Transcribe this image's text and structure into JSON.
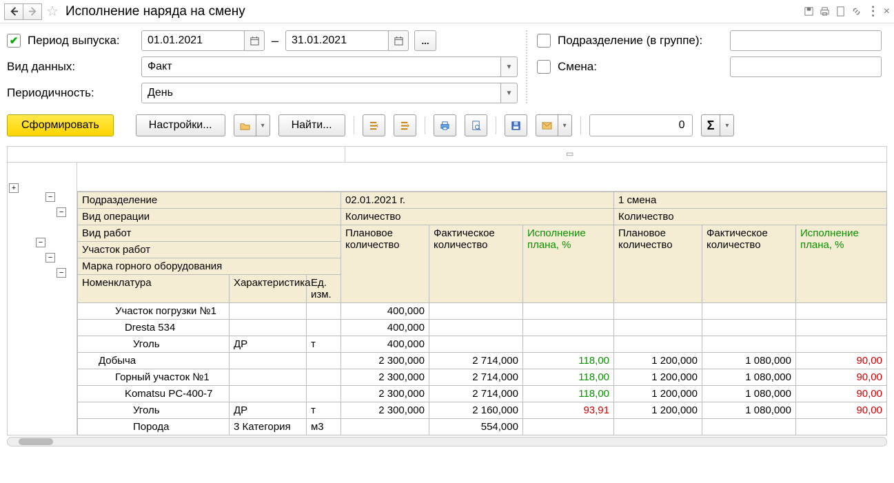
{
  "window": {
    "title": "Исполнение наряда на смену"
  },
  "filters": {
    "periodLabel": "Период выпуска:",
    "dateFrom": "01.01.2021",
    "dateTo": "31.01.2021",
    "dataTypeLabel": "Вид данных:",
    "dataType": "Факт",
    "periodicityLabel": "Периодичность:",
    "periodicity": "День",
    "unitLabel": "Подразделение (в группе):",
    "shiftLabel": "Смена:",
    "ellipsis": "..."
  },
  "toolbar": {
    "generate": "Сформировать",
    "settings": "Настройки...",
    "find": "Найти...",
    "counter": "0",
    "sigma": "Σ"
  },
  "headers": {
    "unit": "Подразделение",
    "opType": "Вид операции",
    "workType": "Вид работ",
    "workArea": "Участок работ",
    "equipment": "Марка горного оборудования",
    "nomenclature": "Номенклатура",
    "characteristic": "Характеристика",
    "uom": "Ед. изм.",
    "date": "02.01.2021 г.",
    "shift": "1 смена",
    "qty": "Количество",
    "plan": "Плановое количество",
    "fact": "Фактическое количество",
    "exec": "Исполнение плана, %"
  },
  "rows": [
    {
      "name": "Участок погрузки №1",
      "char": "",
      "uom": "",
      "indent": 2,
      "d": {
        "plan": "400,000",
        "fact": "",
        "exec": "",
        "execClass": ""
      },
      "s": {
        "plan": "",
        "fact": "",
        "exec": "",
        "execClass": ""
      }
    },
    {
      "name": "Dresta 534",
      "char": "",
      "uom": "",
      "indent": 3,
      "d": {
        "plan": "400,000",
        "fact": "",
        "exec": "",
        "execClass": ""
      },
      "s": {
        "plan": "",
        "fact": "",
        "exec": "",
        "execClass": ""
      }
    },
    {
      "name": "Уголь",
      "char": "ДР",
      "uom": "т",
      "indent": 4,
      "d": {
        "plan": "400,000",
        "fact": "",
        "exec": "",
        "execClass": ""
      },
      "s": {
        "plan": "",
        "fact": "",
        "exec": "",
        "execClass": ""
      }
    },
    {
      "name": "Добыча",
      "char": "",
      "uom": "",
      "indent": 1,
      "d": {
        "plan": "2 300,000",
        "fact": "2 714,000",
        "exec": "118,00",
        "execClass": "green"
      },
      "s": {
        "plan": "1 200,000",
        "fact": "1 080,000",
        "exec": "90,00",
        "execClass": "red"
      }
    },
    {
      "name": "Горный участок №1",
      "char": "",
      "uom": "",
      "indent": 2,
      "d": {
        "plan": "2 300,000",
        "fact": "2 714,000",
        "exec": "118,00",
        "execClass": "green"
      },
      "s": {
        "plan": "1 200,000",
        "fact": "1 080,000",
        "exec": "90,00",
        "execClass": "red"
      }
    },
    {
      "name": "Komatsu PC-400-7",
      "char": "",
      "uom": "",
      "indent": 3,
      "d": {
        "plan": "2 300,000",
        "fact": "2 714,000",
        "exec": "118,00",
        "execClass": "green"
      },
      "s": {
        "plan": "1 200,000",
        "fact": "1 080,000",
        "exec": "90,00",
        "execClass": "red"
      }
    },
    {
      "name": "Уголь",
      "char": "ДР",
      "uom": "т",
      "indent": 4,
      "d": {
        "plan": "2 300,000",
        "fact": "2 160,000",
        "exec": "93,91",
        "execClass": "red"
      },
      "s": {
        "plan": "1 200,000",
        "fact": "1 080,000",
        "exec": "90,00",
        "execClass": "red"
      }
    },
    {
      "name": "Порода",
      "char": "3 Категория",
      "uom": "м3",
      "indent": 4,
      "d": {
        "plan": "",
        "fact": "554,000",
        "exec": "",
        "execClass": ""
      },
      "s": {
        "plan": "",
        "fact": "",
        "exec": "",
        "execClass": ""
      }
    }
  ]
}
